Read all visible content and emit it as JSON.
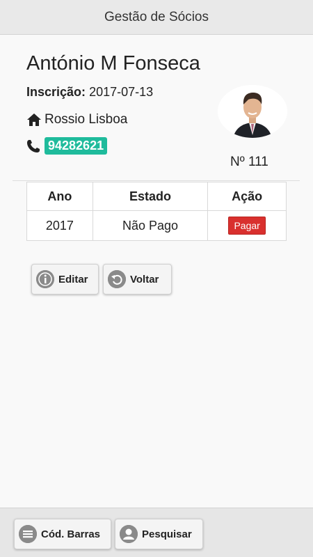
{
  "header": {
    "title": "Gestão de Sócios"
  },
  "member": {
    "name": "António M Fonseca",
    "inscricao_label": "Inscrição:",
    "inscricao_date": "2017-07-13",
    "address": "Rossio Lisboa",
    "phone": "94282621",
    "number": "Nº 111"
  },
  "table": {
    "headers": [
      "Ano",
      "Estado",
      "Ação"
    ],
    "rows": [
      {
        "ano": "2017",
        "estado": "Não Pago",
        "acao": "Pagar"
      }
    ]
  },
  "actions": {
    "edit": "Editar",
    "back": "Voltar"
  },
  "footer": {
    "barcode": "Cód. Barras",
    "search": "Pesquisar"
  },
  "colors": {
    "phone_badge": "#1fbb9c",
    "pay_button": "#d9302e",
    "header_bg": "#e9e9e9"
  },
  "icons": {
    "address": "home-icon",
    "phone": "phone-icon",
    "edit": "info-icon",
    "back": "undo-icon",
    "barcode": "menu-icon",
    "search": "user-icon"
  }
}
